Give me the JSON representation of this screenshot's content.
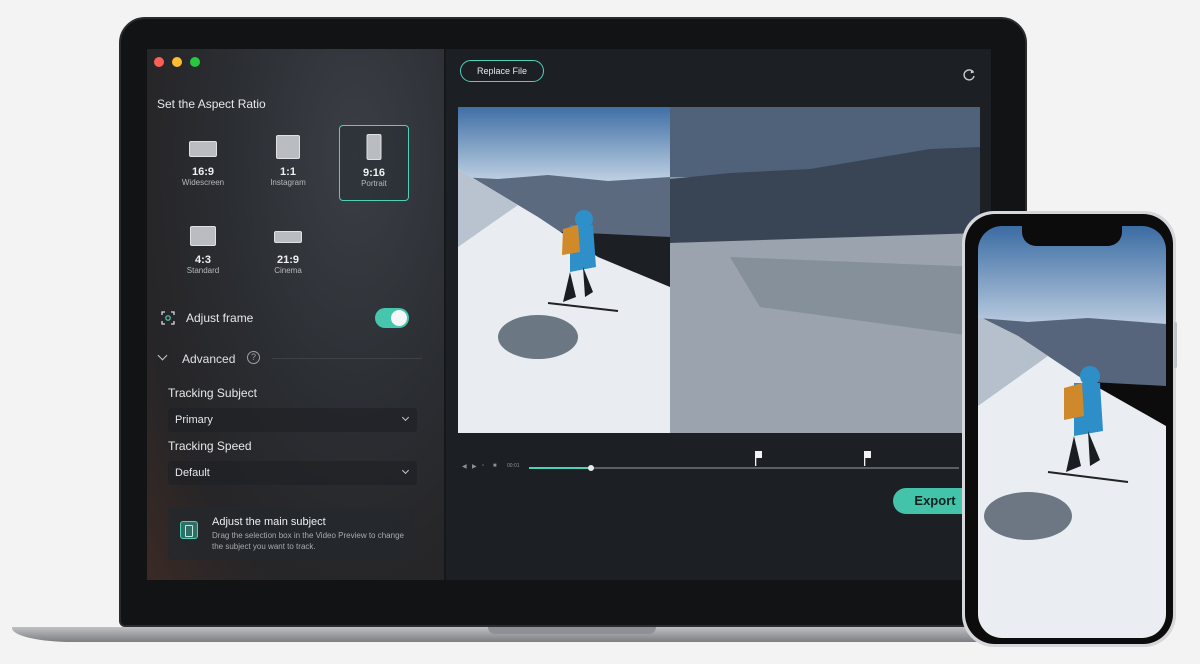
{
  "left_panel": {
    "section_title": "Set the Aspect Ratio",
    "ratios": [
      {
        "ratio": "16:9",
        "name": "Widescreen",
        "selected": false
      },
      {
        "ratio": "1:1",
        "name": "Instagram",
        "selected": false
      },
      {
        "ratio": "9:16",
        "name": "Portrait",
        "selected": true
      },
      {
        "ratio": "4:3",
        "name": "Standard",
        "selected": false
      },
      {
        "ratio": "21:9",
        "name": "Cinema",
        "selected": false
      }
    ],
    "adjust_frame": {
      "label": "Adjust frame",
      "enabled": true
    },
    "advanced": {
      "label": "Advanced",
      "help_glyph": "?"
    },
    "tracking_subject": {
      "label": "Tracking Subject",
      "value": "Primary"
    },
    "tracking_speed": {
      "label": "Tracking Speed",
      "value": "Default"
    },
    "tip": {
      "title": "Adjust the main subject",
      "body": "Drag the selection box in the Video Preview to change the subject you want to track."
    }
  },
  "toolbar": {
    "replace_file": "Replace File"
  },
  "playback": {
    "timecode": "00:01",
    "progress": 0.14
  },
  "export_label": "Export",
  "colors": {
    "accent": "#4fd1b8",
    "export": "#43c4aa",
    "panel": "#2a2d32"
  }
}
